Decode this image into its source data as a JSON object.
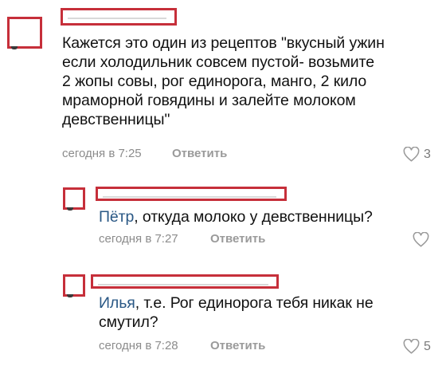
{
  "colors": {
    "redaction": "#c62f3a",
    "link": "#2a5885",
    "meta": "#8c8c8c",
    "text": "#111111"
  },
  "comments": [
    {
      "text": "Кажется это один из рецептов \"вкусный ужин\nесли холодильник совсем пустой- возьмите\n2 жопы совы, рог единорога, манго, 2 кило\nмраморной говядины и залейте молоком\nдевственницы\"",
      "time": "сегодня в 7:25",
      "reply_label": "Ответить",
      "likes": "3",
      "like_icon": "heart-outline-icon"
    },
    {
      "reply_to": "Пётр",
      "text": ", откуда молоко у девственницы?",
      "time": "сегодня в 7:27",
      "reply_label": "Ответить",
      "likes": "",
      "like_icon": "heart-outline-icon"
    },
    {
      "reply_to": "Илья",
      "text": ", т.е. Рог единорога тебя никак не\nсмутил?",
      "time": "сегодня в 7:28",
      "reply_label": "Ответить",
      "likes": "5",
      "like_icon": "heart-outline-icon"
    }
  ]
}
